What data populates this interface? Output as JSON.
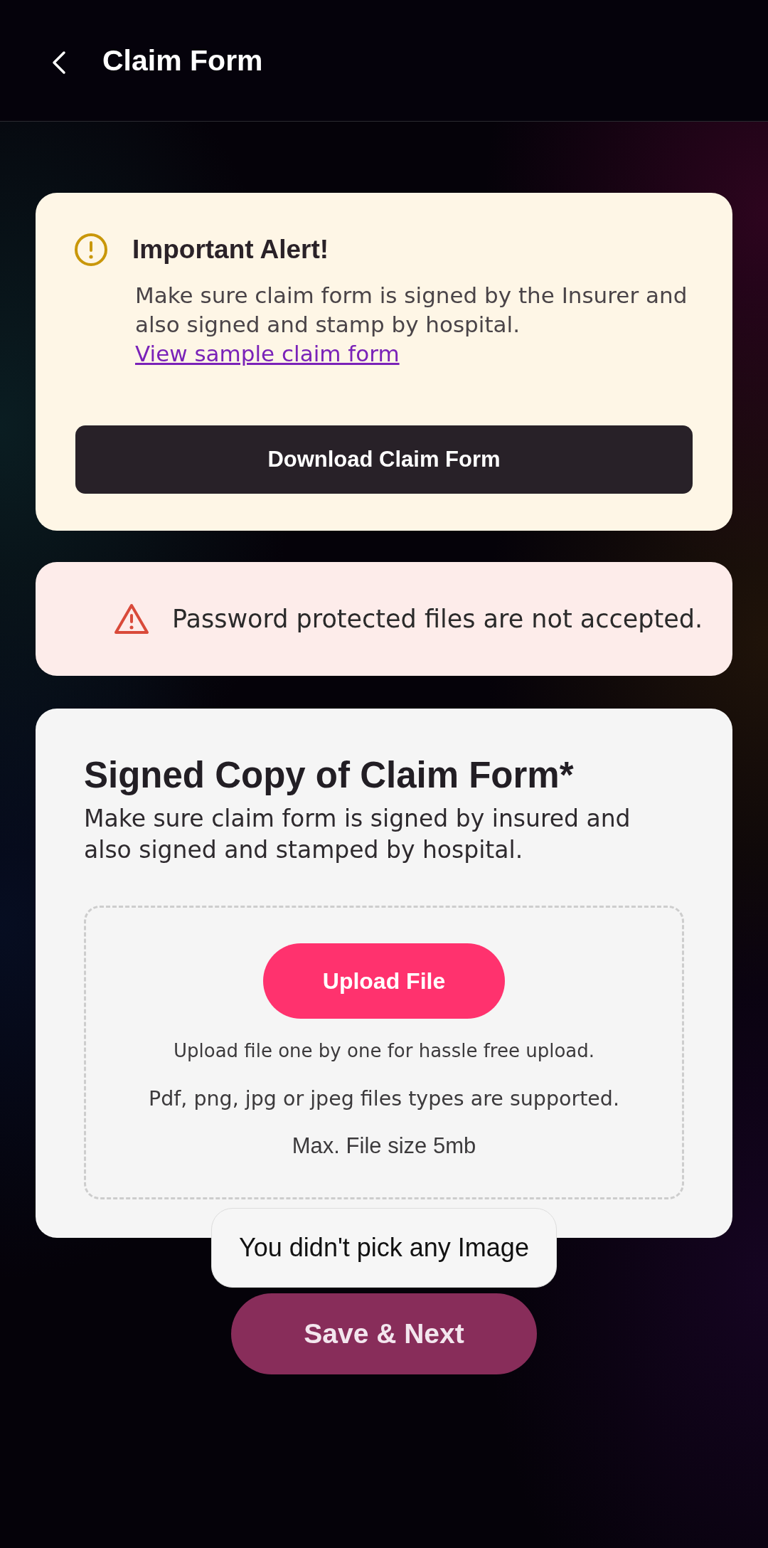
{
  "header": {
    "title": "Claim Form"
  },
  "alert": {
    "title": "Important Alert!",
    "body": "Make sure claim form is signed by the Insurer and also signed and stamp by hospital.",
    "link": "View sample claim form",
    "button": "Download Claim Form"
  },
  "warning": {
    "text": "Password protected files are not accepted."
  },
  "upload": {
    "title": "Signed Copy of Claim Form*",
    "description": "Make sure claim form is signed by insured and also signed and stamped by hospital.",
    "button": "Upload File",
    "notes": [
      "Upload file one by one for hassle free upload.",
      "Pdf, png, jpg or jpeg files types are supported.",
      "Max. File size 5mb"
    ]
  },
  "toast": {
    "text": "You didn't pick any Image"
  },
  "save_button": {
    "label": "Save & Next",
    "disabled": true
  }
}
